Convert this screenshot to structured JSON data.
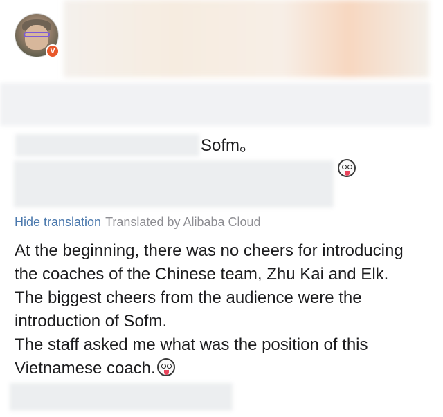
{
  "post": {
    "author_badge": "V",
    "original_text_tail": "Sofm。"
  },
  "translation": {
    "hide_label": "Hide translation",
    "provider_label": "Translated by Alibaba Cloud",
    "lines": [
      "At the beginning, there was no cheers for introducing",
      "the coaches of the Chinese team, Zhu Kai and Elk.",
      "The biggest cheers from the audience were the",
      "introduction of Sofm.",
      "The staff asked me what was the position of this",
      "Vietnamese coach."
    ]
  },
  "icons": {
    "avatar": "user-avatar",
    "verified": "verified-badge-icon",
    "emoji": "shocked-face-emoji-icon"
  },
  "colors": {
    "link": "#4a78ad",
    "muted": "#8e8e93",
    "badge": "#e8572a",
    "text": "#1c1c1e"
  }
}
